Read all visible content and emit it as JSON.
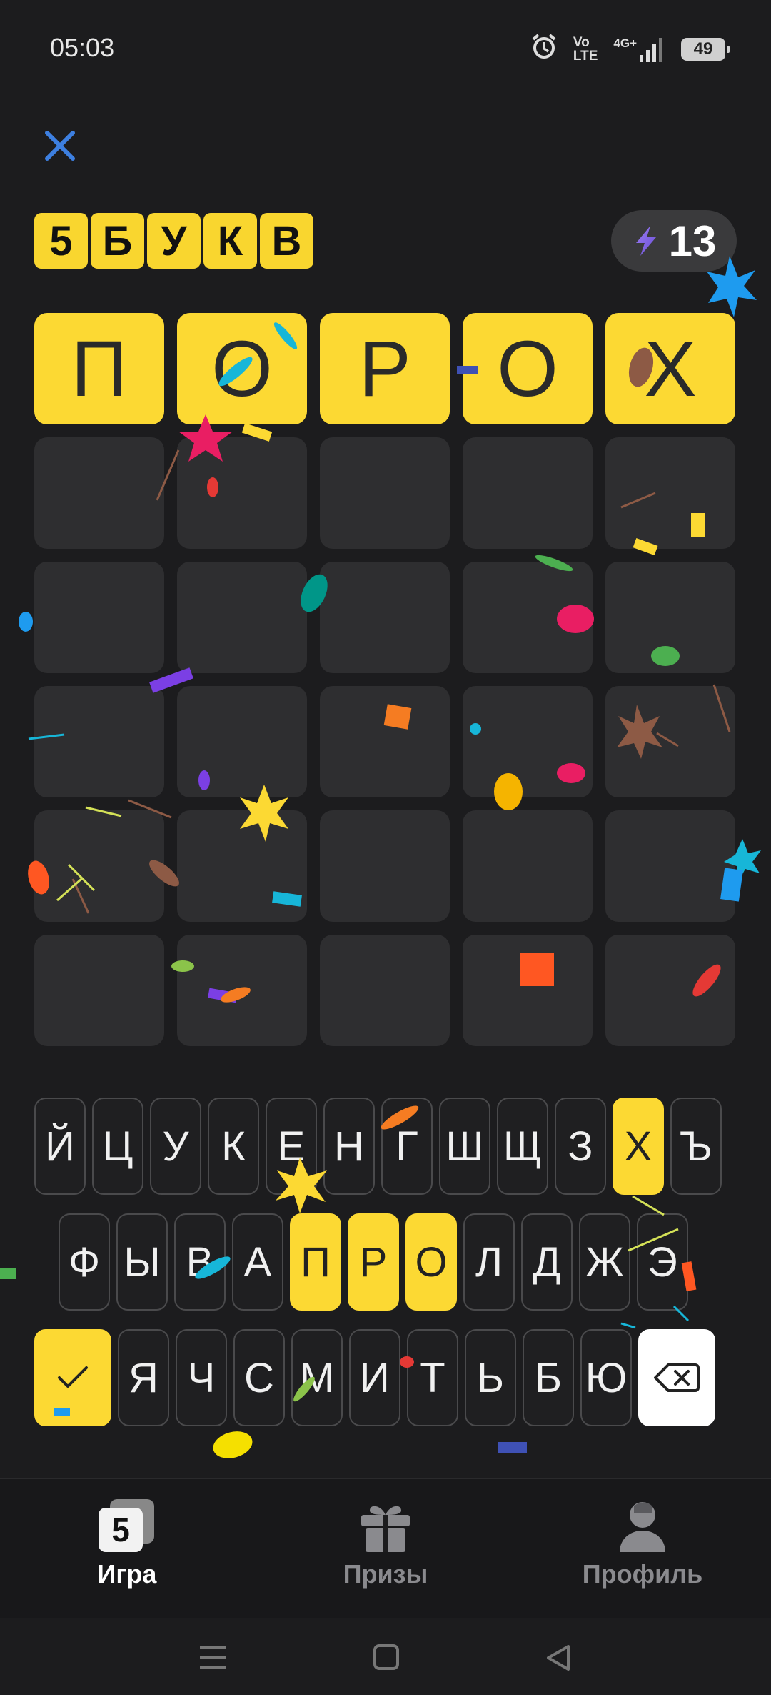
{
  "status_bar": {
    "time": "05:03",
    "icons": [
      "alarm-icon",
      "volte-icon",
      "signal-4g-icon"
    ],
    "volte_text": "Vo\nLTE",
    "network": "4G+",
    "battery": "49"
  },
  "header": {
    "close_icon": "close-icon",
    "logo_letters": [
      "5",
      "Б",
      "У",
      "К",
      "В"
    ],
    "energy_count": "13"
  },
  "board": {
    "rows": [
      [
        "П",
        "О",
        "Р",
        "О",
        "Х"
      ],
      [
        "",
        "",
        "",
        "",
        ""
      ],
      [
        "",
        "",
        "",
        "",
        ""
      ],
      [
        "",
        "",
        "",
        "",
        ""
      ],
      [
        "",
        "",
        "",
        "",
        ""
      ],
      [
        "",
        "",
        "",
        "",
        ""
      ]
    ]
  },
  "keyboard": {
    "row1": [
      "Й",
      "Ц",
      "У",
      "К",
      "Е",
      "Н",
      "Г",
      "Ш",
      "Щ",
      "З",
      "Х",
      "Ъ"
    ],
    "row2": [
      "Ф",
      "Ы",
      "В",
      "А",
      "П",
      "Р",
      "О",
      "Л",
      "Д",
      "Ж",
      "Э"
    ],
    "row3": [
      "Я",
      "Ч",
      "С",
      "М",
      "И",
      "Т",
      "Ь",
      "Б",
      "Ю"
    ],
    "highlighted": [
      "Х",
      "П",
      "Р",
      "О"
    ],
    "submit_icon": "check-icon",
    "backspace_icon": "backspace-icon"
  },
  "bottom_nav": {
    "items": [
      {
        "label": "Игра",
        "icon": "game-icon",
        "badge": "5",
        "active": true
      },
      {
        "label": "Призы",
        "icon": "gift-icon",
        "active": false
      },
      {
        "label": "Профиль",
        "icon": "profile-icon",
        "active": false
      }
    ]
  },
  "system_nav": [
    "menu-icon",
    "home-icon",
    "back-icon"
  ],
  "colors": {
    "accent_yellow": "#fcd933",
    "background": "#1c1c1e",
    "cell_empty": "#2e2e30",
    "close_blue": "#3d7fe0"
  }
}
